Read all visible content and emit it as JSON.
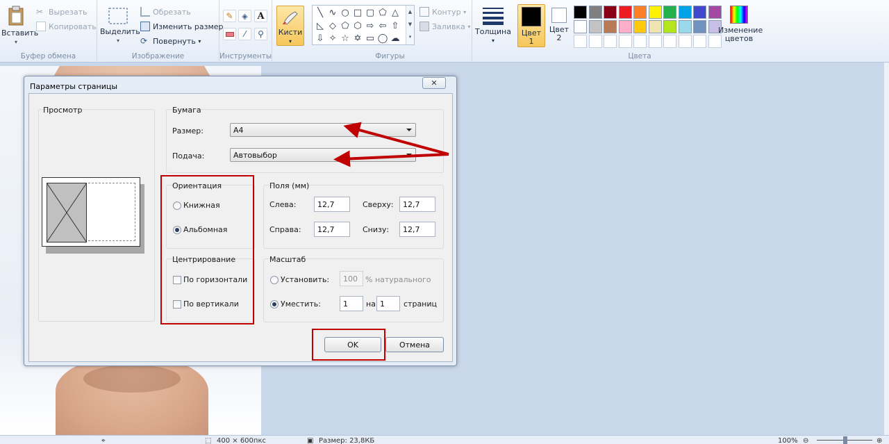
{
  "ribbon": {
    "clipboard": {
      "paste": "Вставить",
      "cut": "Вырезать",
      "copy": "Копировать",
      "group": "Буфер обмена"
    },
    "image": {
      "select": "Выделить",
      "crop": "Обрезать",
      "resize": "Изменить размер",
      "rotate": "Повернуть",
      "group": "Изображение"
    },
    "tools": {
      "group": "Инструменты",
      "items": [
        "pencil-icon",
        "fill-icon",
        "text-icon",
        "eraser-icon",
        "picker-icon",
        "magnifier-icon"
      ]
    },
    "brushes": {
      "label": "Кисти"
    },
    "shapes": {
      "outline": "Контур",
      "fill": "Заливка",
      "group": "Фигуры"
    },
    "size": {
      "label": "Толщина"
    },
    "colors": {
      "color1": "Цвет",
      "color1_num": "1",
      "color2": "Цвет",
      "color2_num": "2",
      "edit": "Изменение цветов",
      "group": "Цвета",
      "palette_row1": [
        "#000000",
        "#7f7f7f",
        "#880015",
        "#ed1c24",
        "#ff7f27",
        "#fff200",
        "#22b14c",
        "#00a2e8",
        "#3f48cc",
        "#a349a4"
      ],
      "palette_row2": [
        "#ffffff",
        "#c3c3c3",
        "#b97a57",
        "#ffaec9",
        "#ffc90e",
        "#efe4b0",
        "#b5e61d",
        "#99d9ea",
        "#7092be",
        "#c8bfe7"
      ]
    }
  },
  "dialog": {
    "title": "Параметры страницы",
    "preview_label": "Просмотр",
    "paper": {
      "group": "Бумага",
      "size_label": "Размер:",
      "size_value": "A4",
      "source_label": "Подача:",
      "source_value": "Автовыбор"
    },
    "orientation": {
      "group": "Ориентация",
      "portrait": "Книжная",
      "landscape": "Альбомная",
      "selected": "landscape"
    },
    "margins": {
      "group": "Поля (мм)",
      "left_label": "Слева:",
      "left_value": "12,7",
      "top_label": "Сверху:",
      "top_value": "12,7",
      "right_label": "Справа:",
      "right_value": "12,7",
      "bottom_label": "Снизу:",
      "bottom_value": "12,7"
    },
    "centering": {
      "group": "Центрирование",
      "horizontal": "По горизонтали",
      "vertical": "По вертикали"
    },
    "scale": {
      "group": "Масштаб",
      "adjust_label": "Установить:",
      "adjust_value": "100",
      "adjust_suffix": "% натурального",
      "fit_label": "Уместить:",
      "fit_w": "1",
      "fit_by": "на",
      "fit_h": "1",
      "fit_suffix": "страниц"
    },
    "ok": "OK",
    "cancel": "Отмена",
    "close": "✕"
  },
  "status": {
    "dimensions": "400 × 600пкс",
    "size": "Размер: 23,8КБ",
    "zoom": "100%"
  },
  "annotation_color": "#c00000"
}
